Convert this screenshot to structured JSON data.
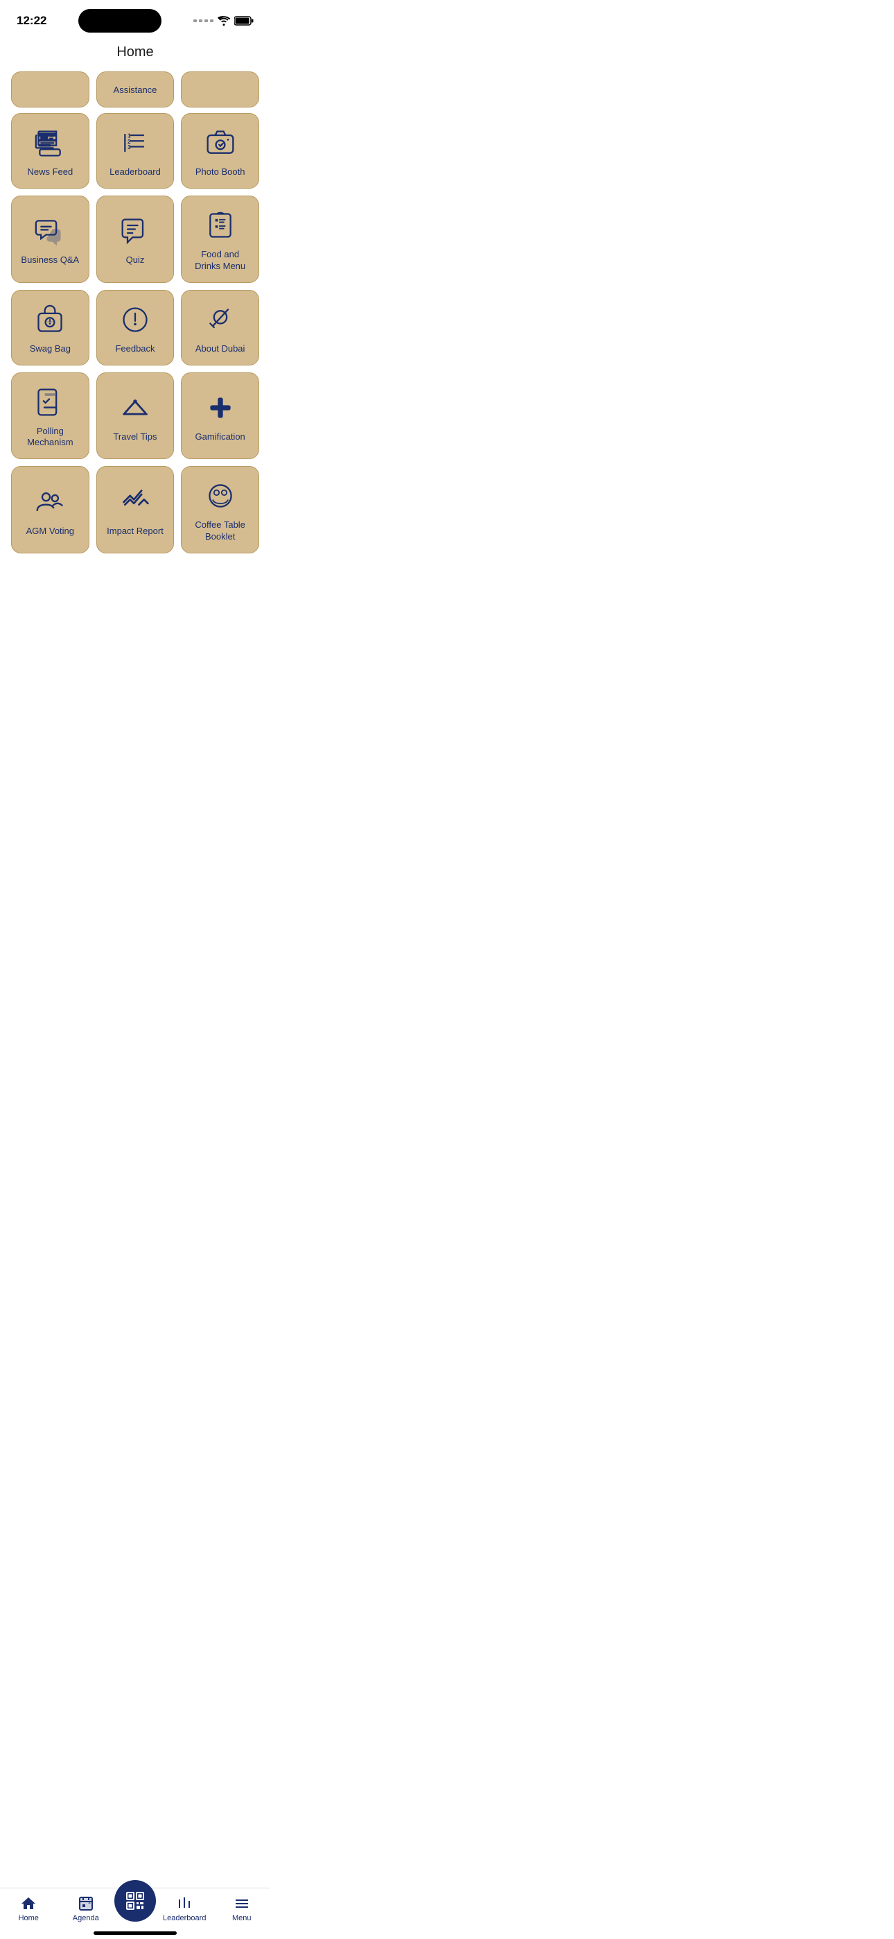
{
  "statusBar": {
    "time": "12:22"
  },
  "header": {
    "title": "Home"
  },
  "partialRow": [
    {
      "label": "",
      "id": "partial-1"
    },
    {
      "label": "Assistance",
      "id": "partial-assistance"
    },
    {
      "label": "",
      "id": "partial-3"
    }
  ],
  "gridItems": [
    {
      "id": "news-feed",
      "label": "News Feed",
      "icon": "news-feed-icon"
    },
    {
      "id": "leaderboard",
      "label": "Leaderboard",
      "icon": "leaderboard-icon"
    },
    {
      "id": "photo-booth",
      "label": "Photo Booth",
      "icon": "photo-booth-icon"
    },
    {
      "id": "business-qa",
      "label": "Business Q&A",
      "icon": "business-qa-icon"
    },
    {
      "id": "quiz",
      "label": "Quiz",
      "icon": "quiz-icon"
    },
    {
      "id": "food-drinks",
      "label": "Food and Drinks Menu",
      "icon": "food-drinks-icon"
    },
    {
      "id": "swag-bag",
      "label": "Swag Bag",
      "icon": "swag-bag-icon"
    },
    {
      "id": "feedback",
      "label": "Feedback",
      "icon": "feedback-icon"
    },
    {
      "id": "about-dubai",
      "label": "About Dubai",
      "icon": "about-dubai-icon"
    },
    {
      "id": "polling-mechanism",
      "label": "Polling Mechanism",
      "icon": "polling-icon"
    },
    {
      "id": "travel-tips",
      "label": "Travel Tips",
      "icon": "travel-tips-icon"
    },
    {
      "id": "gamification",
      "label": "Gamification",
      "icon": "gamification-icon"
    },
    {
      "id": "agm-voting",
      "label": "AGM Voting",
      "icon": "agm-voting-icon"
    },
    {
      "id": "impact-report",
      "label": "Impact Report",
      "icon": "impact-report-icon"
    },
    {
      "id": "coffee-table",
      "label": "Coffee Table Booklet",
      "icon": "coffee-table-icon"
    }
  ],
  "bottomNav": {
    "items": [
      {
        "id": "home",
        "label": "Home",
        "icon": "home-nav-icon",
        "active": true
      },
      {
        "id": "agenda",
        "label": "Agenda",
        "icon": "agenda-nav-icon",
        "active": false
      },
      {
        "id": "qr",
        "label": "",
        "icon": "qr-nav-icon",
        "active": false
      },
      {
        "id": "leaderboard-nav",
        "label": "Leaderboard",
        "icon": "leaderboard-nav-icon",
        "active": false
      },
      {
        "id": "menu-nav",
        "label": "Menu",
        "icon": "menu-nav-icon",
        "active": false
      }
    ]
  }
}
